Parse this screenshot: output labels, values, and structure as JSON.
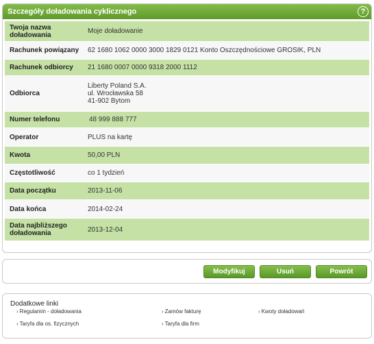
{
  "panel": {
    "title": "Szczegóły doładowania cyklicznego",
    "help_glyph": "?"
  },
  "details": [
    {
      "label": "Twoja nazwa doładowania",
      "value": "Moje doładowanie"
    },
    {
      "label": "Rachunek powiązany",
      "value": "62 1680 1062 0000 3000 1829 0121 Konto Oszczędnościowe GROSIK, PLN"
    },
    {
      "label": "Rachunek odbiorcy",
      "value": "21 1680 0007 0000 9318 2000 1112"
    },
    {
      "label": "Odbiorca",
      "value_lines": [
        "Liberty Poland S.A.",
        "ul. Wrocławska 58",
        "41-902 Bytom"
      ]
    },
    {
      "label": "Numer telefonu",
      "value": "48 999 888 777"
    },
    {
      "label": "Operator",
      "value": "PLUS na kartę"
    },
    {
      "label": "Kwota",
      "value": "50,00 PLN"
    },
    {
      "label": "Częstotliwość",
      "value": "co 1 tydzień"
    },
    {
      "label": "Data początku",
      "value": "2013-11-06"
    },
    {
      "label": "Data końca",
      "value": "2014-02-24"
    },
    {
      "label": "Data najbliższego doładowania",
      "value": "2013-12-04"
    }
  ],
  "buttons": {
    "modify": "Modyfikuj",
    "delete": "Usuń",
    "back": "Powrót"
  },
  "links": {
    "title": "Dodatkowe linki",
    "items": [
      "Regulamin - doładowania",
      "Zamów fakturę",
      "Kwoty doładowań",
      "Taryfa dla os. fizycznych",
      "Taryfa dla firm"
    ],
    "arrow_glyph": "›"
  },
  "colors": {
    "header_green": "#6aa832",
    "row_green": "#c5e1a5",
    "row_light": "#f7f7f7",
    "button_green": "#5a9827"
  }
}
